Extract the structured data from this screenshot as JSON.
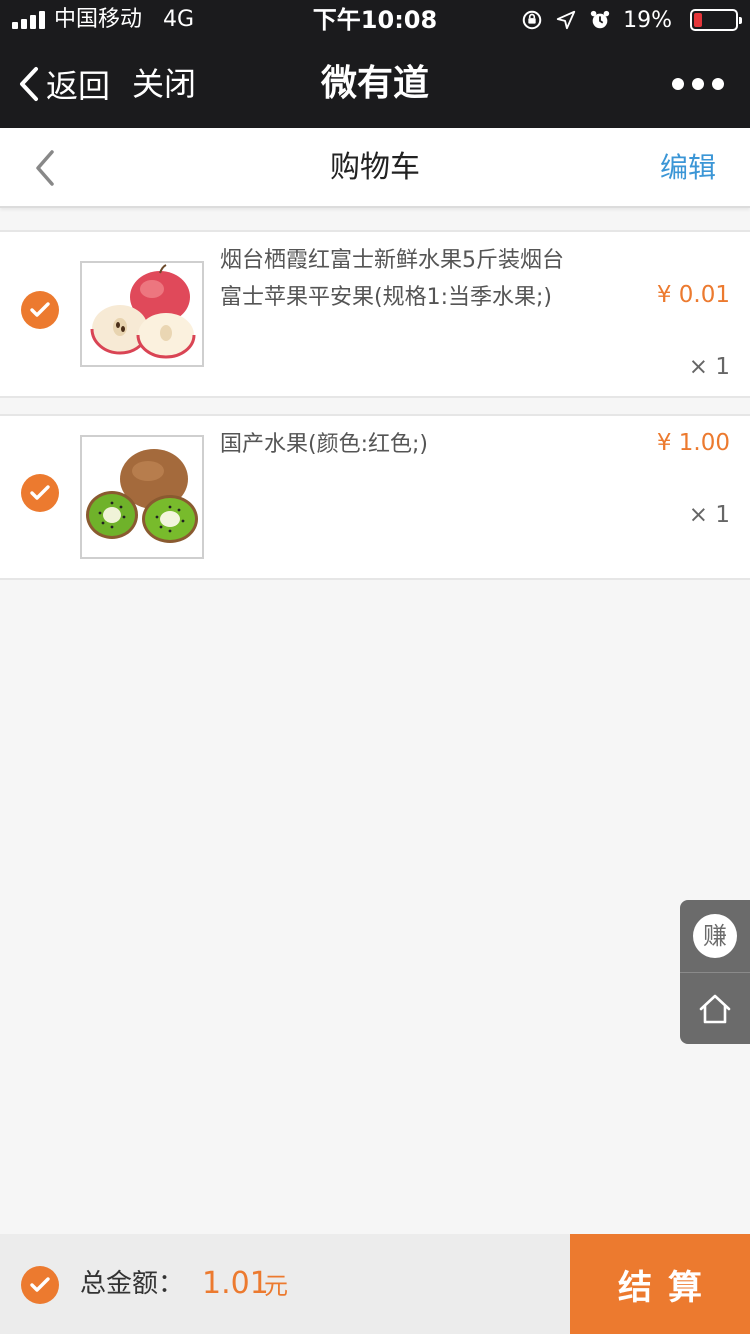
{
  "status_bar": {
    "carrier": "中国移动",
    "network": "4G",
    "time": "下午10:08",
    "battery": "19%",
    "battery_level": 0.19,
    "battery_color": "#e5363a"
  },
  "nav": {
    "back_label": "返回",
    "close_label": "关闭",
    "title": "微有道",
    "more_icon": "more-dots-icon"
  },
  "header": {
    "title": "购物车",
    "edit_label": "编辑",
    "back_icon": "chevron-left-icon"
  },
  "cart": {
    "items": [
      {
        "name": "烟台栖霞红富士新鲜水果5斤装烟台富士苹果平安果(规格1:当季水果;)",
        "price": "¥ 0.01",
        "qty": "× 1",
        "checked": true,
        "image": "apple-photo"
      },
      {
        "name": "国产水果(颜色:红色;)",
        "price": "¥ 1.00",
        "qty": "× 1",
        "checked": true,
        "image": "kiwi-photo"
      }
    ]
  },
  "float_buttons": {
    "earn_label": "赚",
    "home_icon": "home-icon"
  },
  "footer": {
    "total_label": "总金额：",
    "total_value": "1.01",
    "total_unit": "元",
    "checkout_label": "结算"
  },
  "colors": {
    "accent": "#ec7a2f",
    "link": "#3b96d6",
    "dark_bar": "#1b1b1d"
  }
}
